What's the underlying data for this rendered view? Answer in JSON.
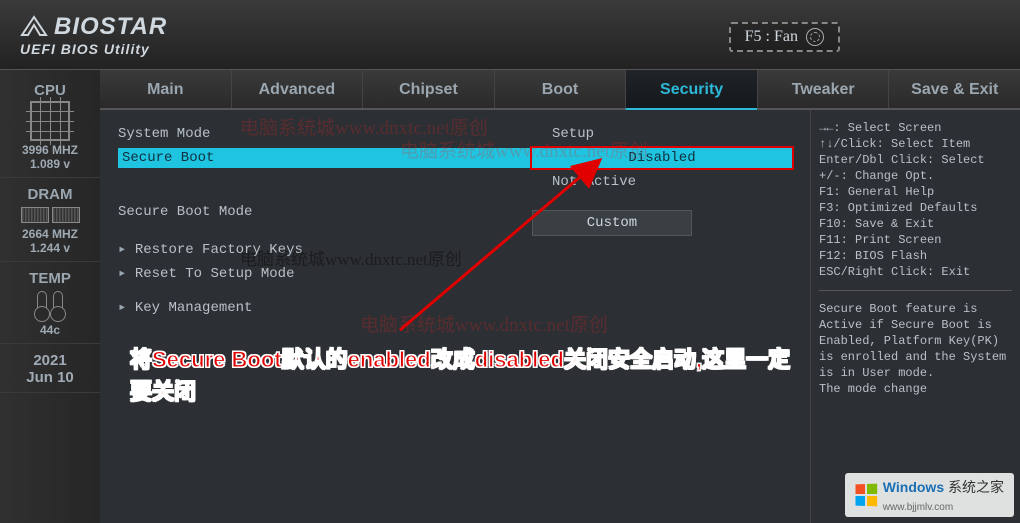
{
  "brand": {
    "name": "BIOSTAR",
    "subtitle": "UEFI BIOS Utility"
  },
  "topbar": {
    "fan_hint": "F5 : Fan"
  },
  "tabs": [
    {
      "label": "Main"
    },
    {
      "label": "Advanced"
    },
    {
      "label": "Chipset"
    },
    {
      "label": "Boot"
    },
    {
      "label": "Security",
      "active": true
    },
    {
      "label": "Tweaker"
    },
    {
      "label": "Save & Exit"
    }
  ],
  "sidebar": {
    "cpu": {
      "title": "CPU",
      "value": "3996 MHZ",
      "volt": "1.089 v"
    },
    "dram": {
      "title": "DRAM",
      "value": "2664 MHZ",
      "volt": "1.244 v"
    },
    "temp": {
      "title": "TEMP",
      "value": "44c"
    },
    "date": {
      "year": "2021",
      "month_day": "Jun 10"
    }
  },
  "panel": {
    "header_left": "System Mode",
    "header_right": "Setup",
    "item_secure_boot": "Secure Boot",
    "value_secure_boot": "Disabled",
    "status_secure_boot": "Not Active",
    "custom_label": "Custom",
    "menu": {
      "secure_boot_mode": "Secure Boot Mode",
      "restore_keys": "Restore Factory Keys",
      "reset_setup": "Reset To Setup Mode",
      "key_mgmt": "Key Management"
    }
  },
  "help": {
    "keys": "→←: Select Screen\n↑↓/Click: Select Item\nEnter/Dbl Click: Select\n+/-: Change Opt.\nF1: General Help\nF3: Optimized Defaults\nF10: Save & Exit\nF11: Print Screen\nF12: BIOS Flash\nESC/Right Click: Exit",
    "desc": "Secure Boot feature is Active if Secure Boot is Enabled, Platform Key(PK) is enrolled and the System is in User mode.\nThe mode change"
  },
  "annotation": {
    "text": "将Secure Boot默认的enabled改成disabled关闭安全启动,这里一定要关闭",
    "watermark_a": "电脑系统城www.dnxtc.net原创",
    "watermark_b": "电脑系统城www.dnxtc.net原创",
    "watermark_c": "电脑系统城www.dnxtc.net原创",
    "watermark_d": "电脑系统城www.dnxtc.net原创"
  },
  "site_watermark": {
    "brand": "Windows",
    "text": "系统之家",
    "url": "www.bjjmlv.com"
  }
}
